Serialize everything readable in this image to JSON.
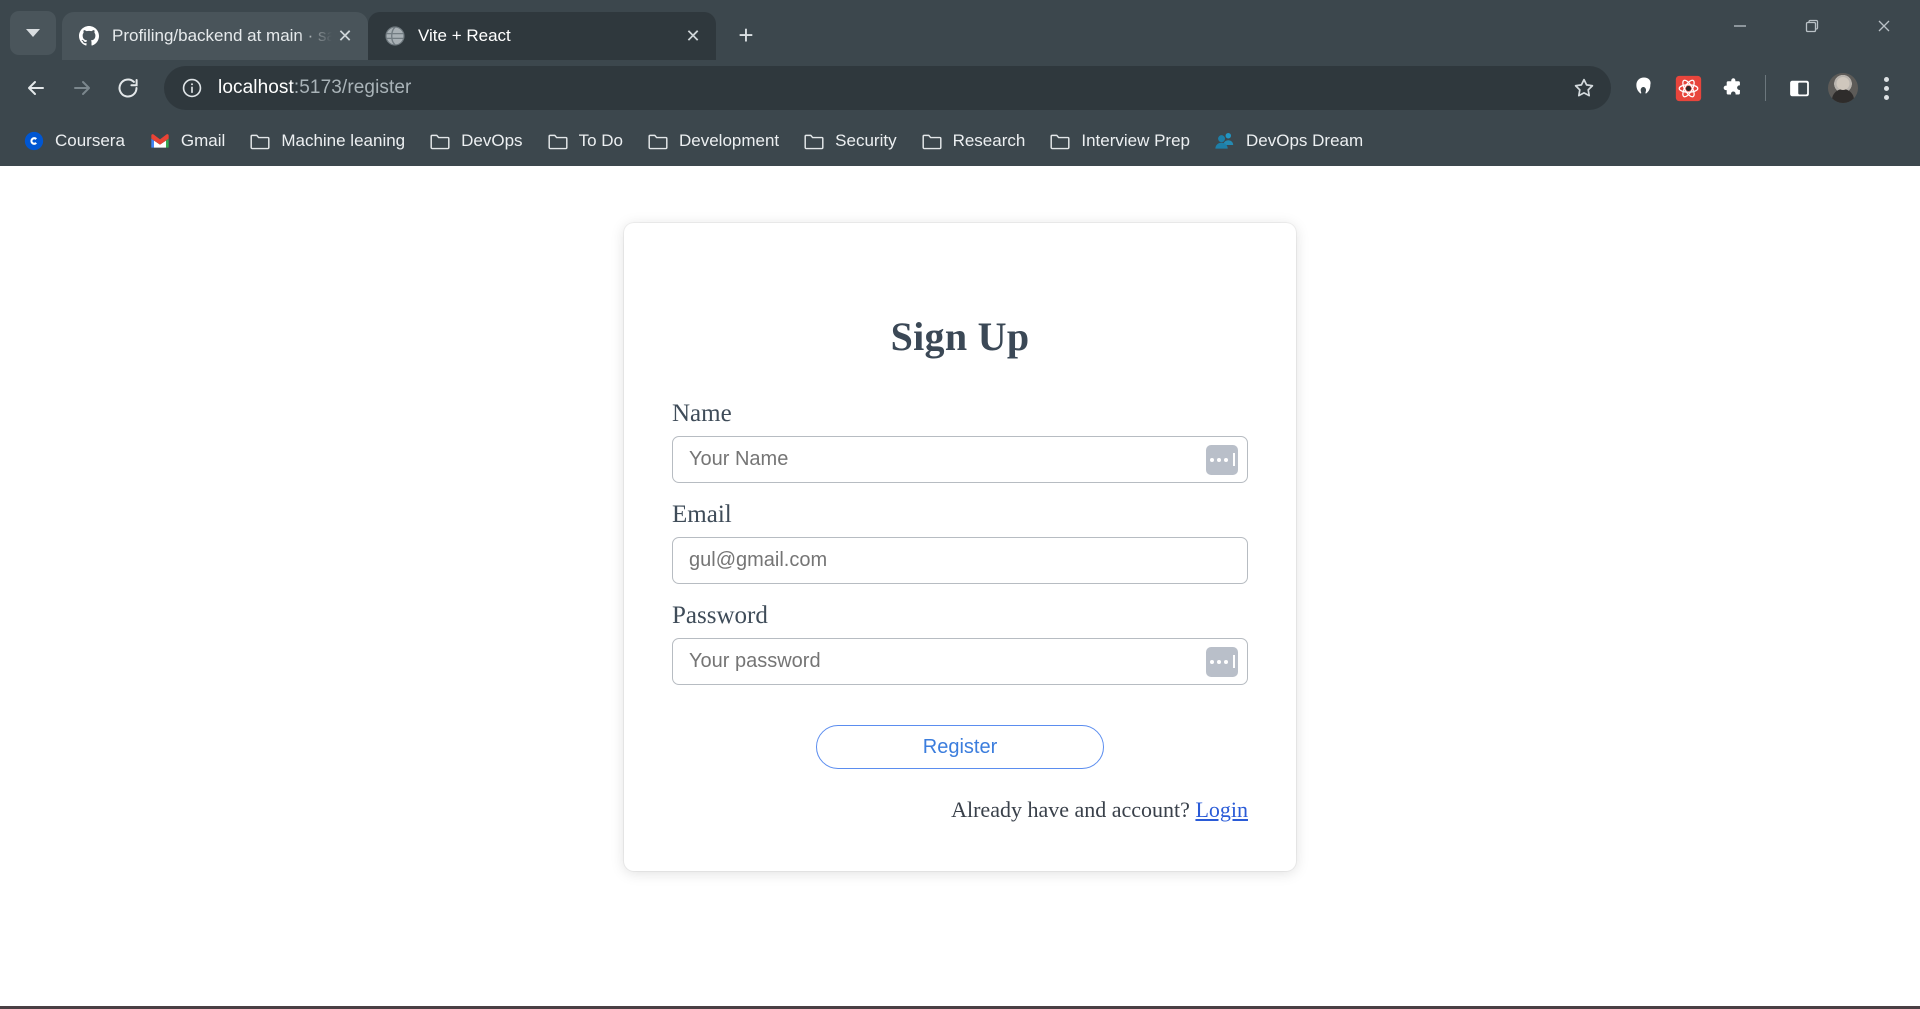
{
  "window": {
    "controls": {
      "minimize": "—",
      "maximize": "❐",
      "close": "✕"
    }
  },
  "tabstrip": {
    "tab_search_tooltip": "Search tabs",
    "new_tab_label": "+",
    "tabs": [
      {
        "title": "Profiling/backend at main · sam",
        "favicon": "github-icon",
        "active": false,
        "close_label": "✕"
      },
      {
        "title": "Vite + React",
        "favicon": "globe-icon",
        "active": true,
        "close_label": "✕"
      }
    ]
  },
  "toolbar": {
    "back_label": "←",
    "forward_label": "→",
    "reload_label": "↻",
    "site_info_icon": "info-circle-icon",
    "url_host": "localhost",
    "url_path": ":5173/register",
    "url_full": "localhost:5173/register",
    "bookmark_star_icon": "star-icon",
    "extensions": [
      {
        "name": "malwarebytes-extension-icon",
        "color": "#ffffff"
      },
      {
        "name": "react-devtools-extension-icon",
        "color": "#e8453c"
      },
      {
        "name": "extensions-puzzle-icon",
        "color": "#ffffff"
      }
    ],
    "side_panel_icon": "side-panel-icon",
    "profile_icon": "profile-avatar",
    "menu_icon": "three-dot-menu-icon"
  },
  "bookmarks": [
    {
      "label": "Coursera",
      "icon": "coursera-icon"
    },
    {
      "label": "Gmail",
      "icon": "gmail-icon"
    },
    {
      "label": "Machine leaning",
      "icon": "folder-icon"
    },
    {
      "label": "DevOps",
      "icon": "folder-icon"
    },
    {
      "label": "To Do",
      "icon": "folder-icon"
    },
    {
      "label": "Development",
      "icon": "folder-icon"
    },
    {
      "label": "Security",
      "icon": "folder-icon"
    },
    {
      "label": "Research",
      "icon": "folder-icon"
    },
    {
      "label": "Interview Prep",
      "icon": "folder-icon"
    },
    {
      "label": "DevOps Dream",
      "icon": "people-icon"
    }
  ],
  "page": {
    "title": "Sign Up",
    "fields": {
      "name": {
        "label": "Name",
        "value": "",
        "placeholder": "Your Name",
        "has_autofill_icon": true
      },
      "email": {
        "label": "Email",
        "value": "",
        "placeholder": "gul@gmail.com",
        "has_autofill_icon": false
      },
      "password": {
        "label": "Password",
        "value": "",
        "placeholder": "Your password",
        "has_autofill_icon": true
      }
    },
    "submit_label": "Register",
    "login_prompt": "Already have and account?",
    "login_link_label": "Login",
    "colors": {
      "accent": "#3b7ddd",
      "link": "#2a5bd7",
      "title": "#3b4856",
      "placeholder": "#808a92",
      "border": "#b7bcc2"
    }
  }
}
